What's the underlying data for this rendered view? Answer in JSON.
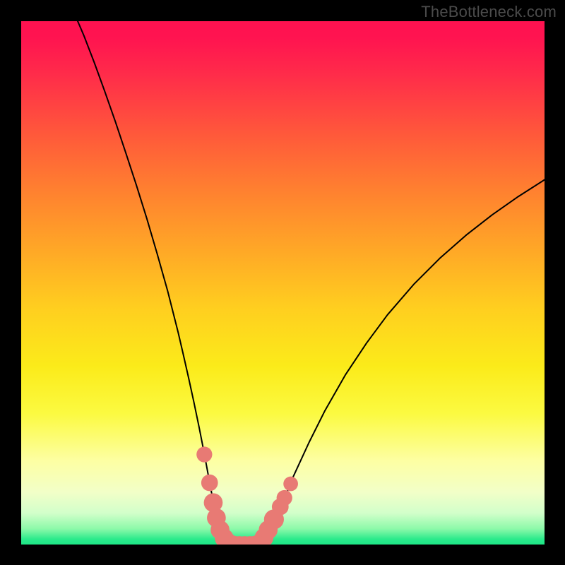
{
  "watermark": "TheBottleneck.com",
  "chart_data": {
    "type": "line",
    "title": "",
    "xlabel": "",
    "ylabel": "",
    "xlim": [
      0,
      100
    ],
    "ylim": [
      0,
      100
    ],
    "grid": false,
    "series": [
      {
        "name": "curve",
        "x": [
          10.8,
          12,
          14,
          16,
          18,
          20,
          22,
          24,
          26,
          28,
          30,
          31,
          32,
          33,
          34,
          35,
          36,
          37,
          38,
          39,
          40,
          41,
          42,
          43,
          44,
          45,
          46,
          48,
          50,
          52,
          55,
          58,
          62,
          66,
          70,
          75,
          80,
          85,
          90,
          95,
          100
        ],
        "values": [
          100,
          97.2,
          92.0,
          86.5,
          80.8,
          74.8,
          68.7,
          62.3,
          55.5,
          48.4,
          40.5,
          36.2,
          31.8,
          27.2,
          22.4,
          17.3,
          11.9,
          6.6,
          3.0,
          1.0,
          0.2,
          0.0,
          0.0,
          0.0,
          0.0,
          0.1,
          0.5,
          3.5,
          8.0,
          13.0,
          19.5,
          25.5,
          32.5,
          38.5,
          43.9,
          49.7,
          54.7,
          59.1,
          63.0,
          66.5,
          69.7
        ]
      }
    ],
    "markers": [
      {
        "x": 35.0,
        "y": 17.2,
        "r": 1.5
      },
      {
        "x": 36.0,
        "y": 11.8,
        "r": 1.6
      },
      {
        "x": 36.7,
        "y": 8.0,
        "r": 1.8
      },
      {
        "x": 37.3,
        "y": 5.1,
        "r": 1.8
      },
      {
        "x": 38.0,
        "y": 2.8,
        "r": 1.8
      },
      {
        "x": 38.8,
        "y": 1.2,
        "r": 1.8
      },
      {
        "x": 39.7,
        "y": 0.35,
        "r": 1.7
      },
      {
        "x": 40.7,
        "y": 0.05,
        "r": 1.6
      },
      {
        "x": 41.7,
        "y": 0.0,
        "r": 1.6
      },
      {
        "x": 42.7,
        "y": 0.0,
        "r": 1.6
      },
      {
        "x": 43.7,
        "y": 0.0,
        "r": 1.6
      },
      {
        "x": 44.6,
        "y": 0.05,
        "r": 1.6
      },
      {
        "x": 45.6,
        "y": 0.35,
        "r": 1.7
      },
      {
        "x": 46.4,
        "y": 1.3,
        "r": 1.8
      },
      {
        "x": 47.2,
        "y": 2.8,
        "r": 1.8
      },
      {
        "x": 48.3,
        "y": 4.8,
        "r": 1.9
      },
      {
        "x": 49.5,
        "y": 7.2,
        "r": 1.6
      },
      {
        "x": 50.3,
        "y": 8.9,
        "r": 1.5
      },
      {
        "x": 51.5,
        "y": 11.6,
        "r": 1.4
      }
    ],
    "marker_color": "#e87a74",
    "line_color": "#000000",
    "gradient": {
      "top": "#ff1250",
      "mid": "#fbeb1a",
      "bottom": "#1ee686"
    }
  }
}
